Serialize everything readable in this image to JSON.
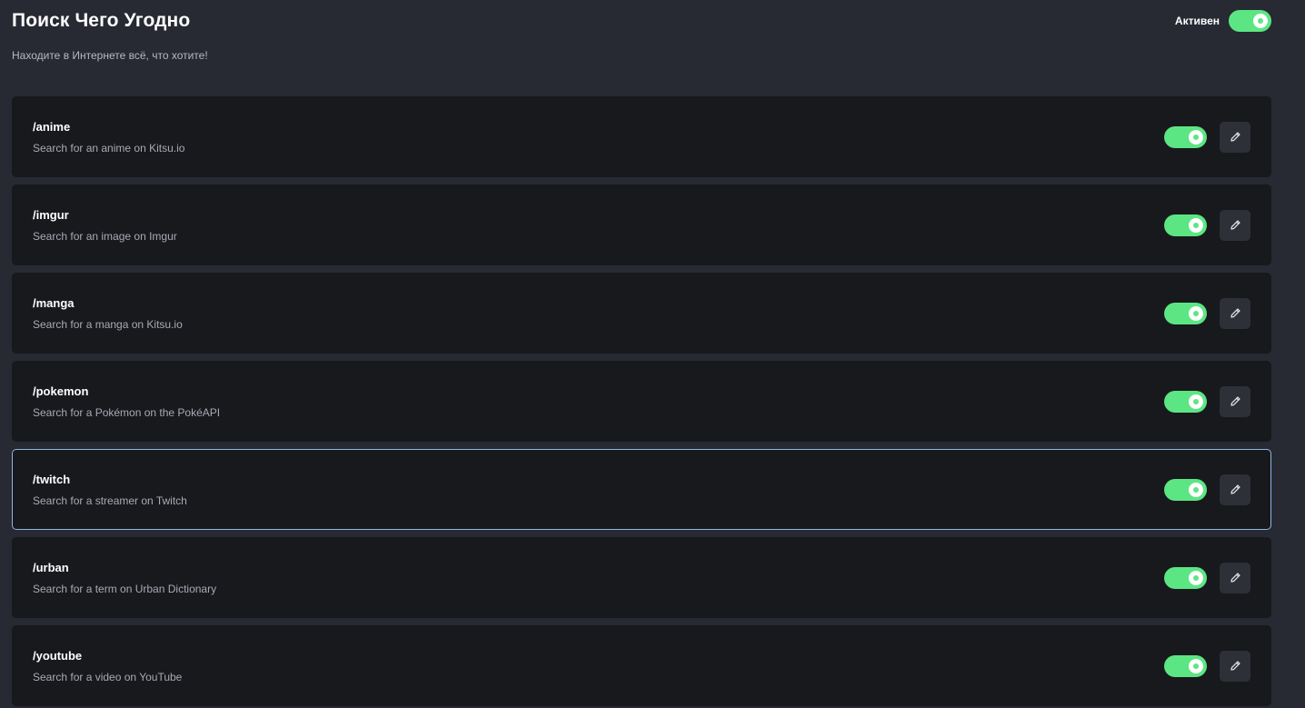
{
  "header": {
    "title": "Поиск Чего Угодно",
    "subtitle": "Находите в Интернете всё, что хотите!",
    "active_label": "Активен",
    "active": true
  },
  "colors": {
    "background": "#272933",
    "card": "#18191d",
    "toggle_on": "#5ce683",
    "focus_border": "#8fb7e4"
  },
  "commands": [
    {
      "name": "/anime",
      "description": "Search for an anime on Kitsu.io",
      "enabled": true,
      "icon": "pencil-icon"
    },
    {
      "name": "/imgur",
      "description": "Search for an image on Imgur",
      "enabled": true,
      "icon": "pencil-icon"
    },
    {
      "name": "/manga",
      "description": "Search for a manga on Kitsu.io",
      "enabled": true,
      "icon": "pencil-icon"
    },
    {
      "name": "/pokemon",
      "description": "Search for a Pokémon on the PokéAPI",
      "enabled": true,
      "icon": "pencil-icon"
    },
    {
      "name": "/twitch",
      "description": "Search for a streamer on Twitch",
      "enabled": true,
      "icon": "pencil-icon",
      "focused": true
    },
    {
      "name": "/urban",
      "description": "Search for a term on Urban Dictionary",
      "enabled": true,
      "icon": "pencil-icon"
    },
    {
      "name": "/youtube",
      "description": "Search for a video on YouTube",
      "enabled": true,
      "icon": "pencil-icon"
    }
  ]
}
